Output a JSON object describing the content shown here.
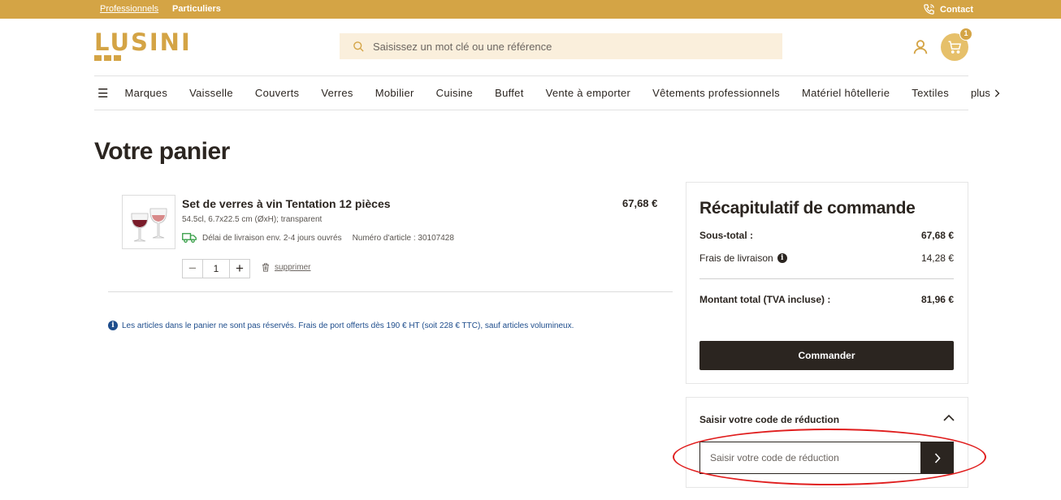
{
  "topbar": {
    "professionals": "Professionnels",
    "individuals": "Particuliers",
    "contact": "Contact"
  },
  "header": {
    "logo": "LUSINI",
    "search_placeholder": "Saisissez un mot clé ou une référence",
    "cart_count": "1"
  },
  "nav": {
    "items": [
      "Marques",
      "Vaisselle",
      "Couverts",
      "Verres",
      "Mobilier",
      "Cuisine",
      "Buffet",
      "Vente à emporter",
      "Vêtements professionnels",
      "Matériel hôtellerie",
      "Textiles"
    ],
    "more": "plus"
  },
  "page": {
    "title": "Votre panier"
  },
  "cart_item": {
    "name": "Set de verres à vin Tentation 12 pièces",
    "price": "67,68 €",
    "spec": "54.5cl, 6.7x22.5 cm (ØxH); transparent",
    "delivery": "Délai de livraison env. 2-4 jours ouvrés",
    "article_number": "Numéro d'article : 30107428",
    "quantity": "1",
    "remove_label": "supprimer"
  },
  "notice": "Les articles dans le panier ne sont pas réservés. Frais de port offerts dès 190 € HT (soit 228 € TTC), sauf articles volumineux.",
  "summary": {
    "title": "Récapitulatif de commande",
    "subtotal_label": "Sous-total :",
    "subtotal_value": "67,68 €",
    "shipping_label": "Frais de livraison",
    "shipping_value": "14,28 €",
    "total_label": "Montant total (TVA incluse) :",
    "total_value": "81,96 €",
    "order_button": "Commander"
  },
  "discount": {
    "title": "Saisir votre code de réduction",
    "placeholder": "Saisir votre code de réduction"
  },
  "colors": {
    "brand": "#d4a445",
    "dark": "#2b2520",
    "notice": "#1e4d8c",
    "highlight": "#e01e1e"
  }
}
